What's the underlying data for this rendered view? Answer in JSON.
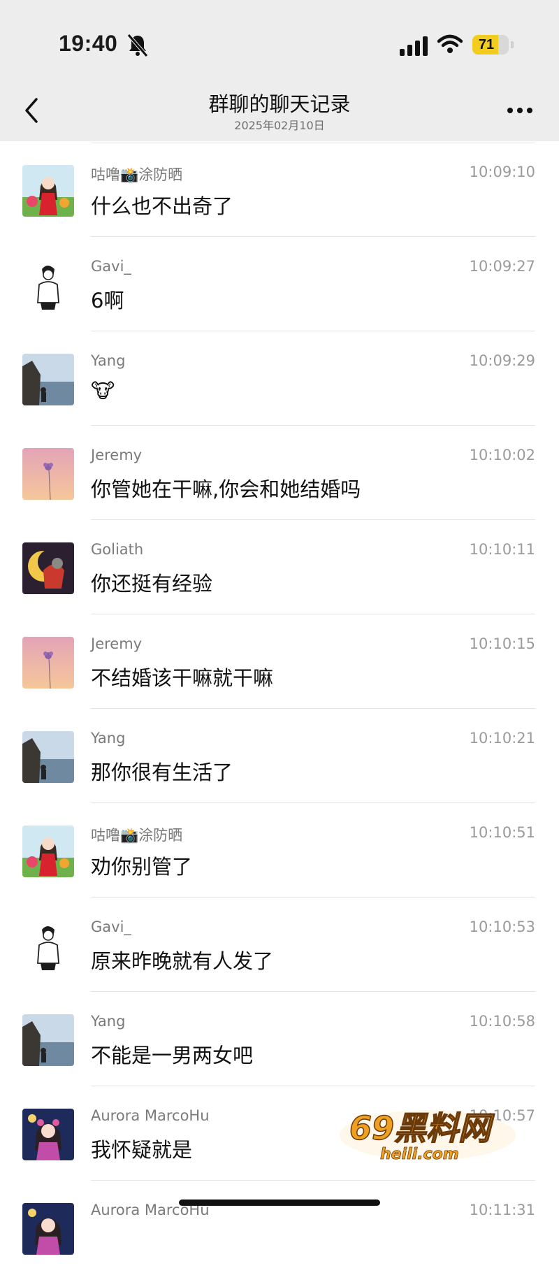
{
  "status_bar": {
    "time": "19:40",
    "battery": "71",
    "battery_level": 0.71
  },
  "nav": {
    "title": "群聊的聊天记录",
    "subtitle": "2025年02月10日"
  },
  "messages": [
    {
      "sender": "咕噜📸涂防晒",
      "time": "10:09:10",
      "text": "什么也不出奇了",
      "avatar": "girl"
    },
    {
      "sender": "Gavi_",
      "time": "10:09:27",
      "text": "6啊",
      "avatar": "sketch"
    },
    {
      "sender": "Yang",
      "time": "10:09:29",
      "text": "🐮",
      "avatar": "seaside"
    },
    {
      "sender": "Jeremy",
      "time": "10:10:02",
      "text": "你管她在干嘛,你会和她结婚吗",
      "avatar": "flower"
    },
    {
      "sender": "Goliath",
      "time": "10:10:11",
      "text": "你还挺有经验",
      "avatar": "moon"
    },
    {
      "sender": "Jeremy",
      "time": "10:10:15",
      "text": "不结婚该干嘛就干嘛",
      "avatar": "flower"
    },
    {
      "sender": "Yang",
      "time": "10:10:21",
      "text": "那你很有生活了",
      "avatar": "seaside"
    },
    {
      "sender": "咕噜📸涂防晒",
      "time": "10:10:51",
      "text": "劝你别管了",
      "avatar": "girl"
    },
    {
      "sender": "Gavi_",
      "time": "10:10:53",
      "text": "原来昨晚就有人发了",
      "avatar": "sketch"
    },
    {
      "sender": "Yang",
      "time": "10:10:58",
      "text": "不能是一男两女吧",
      "avatar": "seaside"
    },
    {
      "sender": "Aurora MarcoHu",
      "time": "10:10:57",
      "text": "我怀疑就是",
      "avatar": "anime"
    },
    {
      "sender": "Aurora MarcoHu",
      "time": "10:11:31",
      "text": "",
      "avatar": "anime"
    }
  ],
  "watermark": {
    "line1": "69黑料网",
    "line2": "heili.com"
  },
  "icons": [
    "bell-slash-icon",
    "signal-icon",
    "wifi-icon",
    "back-icon",
    "more-icon"
  ]
}
